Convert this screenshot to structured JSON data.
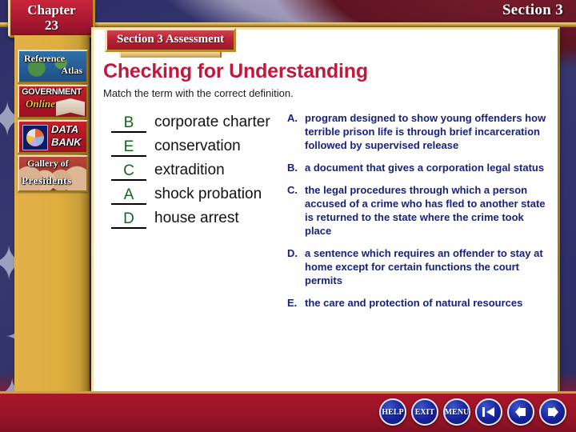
{
  "header": {
    "section_label": "Section 3",
    "chapter_word": "Chapter",
    "chapter_number": "23"
  },
  "sidebar": {
    "items": [
      {
        "id": "reference-atlas",
        "line1": "Reference",
        "line2": "Atlas",
        "icon": "map-icon"
      },
      {
        "id": "government-online",
        "line1": "GOVERNMENT",
        "line2": "Online",
        "icon": "book-icon"
      },
      {
        "id": "data-bank",
        "line1": "DATA",
        "line2": "BANK",
        "icon": "pie-chart-icon"
      },
      {
        "id": "gallery-of-presidents",
        "line1": "Gallery of",
        "line2": "Presidents",
        "icon": "presidents-icon"
      }
    ]
  },
  "content": {
    "banner": "Section 3 Assessment",
    "title": "Checking for Understanding",
    "subtitle": "Match the term with the correct definition.",
    "terms": [
      {
        "answer": "B",
        "term": "corporate charter"
      },
      {
        "answer": "E",
        "term": "conservation"
      },
      {
        "answer": "C",
        "term": "extradition"
      },
      {
        "answer": "A",
        "term": "shock probation"
      },
      {
        "answer": "D",
        "term": "house arrest"
      }
    ],
    "definitions": [
      {
        "letter": "A.",
        "text": "program designed to show young offenders how terrible prison life is through brief incarceration followed by supervised release"
      },
      {
        "letter": "B.",
        "text": "a document that gives a corporation legal status"
      },
      {
        "letter": "C.",
        "text": "the legal procedures through which a person accused of a crime who has fled to another state is returned to the state where the crime took place"
      },
      {
        "letter": "D.",
        "text": "a sentence which requires an offender to stay at home except for certain functions the court permits"
      },
      {
        "letter": "E.",
        "text": "the care and protection of natural resources"
      }
    ]
  },
  "bottom_nav": {
    "buttons": [
      {
        "id": "help",
        "label": "HELP",
        "type": "text"
      },
      {
        "id": "exit",
        "label": "EXIT",
        "type": "text"
      },
      {
        "id": "menu",
        "label": "MENU",
        "type": "text"
      },
      {
        "id": "first",
        "label": "",
        "type": "first-arrow"
      },
      {
        "id": "back",
        "label": "",
        "type": "back-arrow"
      },
      {
        "id": "forward",
        "label": "",
        "type": "forward-arrow"
      }
    ]
  },
  "colors": {
    "title_red": "#c2183c",
    "answer_green": "#14651f",
    "definition_navy": "#17227d",
    "gold": "#e0ad3e",
    "banner_red": "#b82434"
  }
}
